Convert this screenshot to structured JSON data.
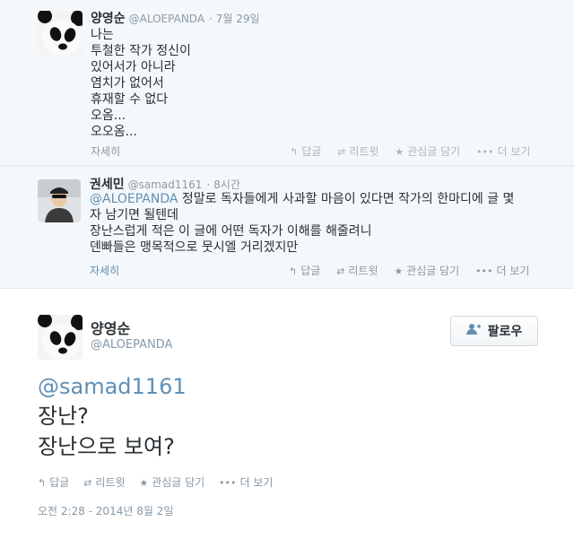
{
  "replies": [
    {
      "fullname": "양영순",
      "handle": "@ALOEPANDA",
      "time": "· 7월 29일",
      "lines": [
        "나는",
        "투철한 작가 정신이",
        "있어서가 아니라",
        "염치가 없어서",
        "휴재할 수 없다",
        "오옴...",
        "오오옴..."
      ],
      "expand": "자세히",
      "actions": {
        "reply": "답글",
        "retweet": "리트윗",
        "favorite": "관심글 담기",
        "more": "더 보기"
      }
    },
    {
      "fullname": "권세민",
      "handle": "@samad1161",
      "time": "· 8시간",
      "mention": "@ALOEPANDA",
      "lines": [
        "정말로 독자들에게 사과할 마음이 있다면 작가의 한마디에 글 몇",
        "자 남기면 될텐데",
        "장난스럽게 적은 이 글에 어떤 독자가 이해를 해줄려니",
        "덴빠들은 맹목적으로 뭇시엘 거리겠지만"
      ],
      "expand": "자세히",
      "actions": {
        "reply": "답글",
        "retweet": "리트윗",
        "favorite": "관심글 담기",
        "more": "더 보기"
      }
    }
  ],
  "main": {
    "fullname": "양영순",
    "handle": "@ALOEPANDA",
    "follow_label": "팔로우",
    "mention": "@samad1161",
    "lines": [
      "장난?",
      "장난으로 보여?"
    ],
    "actions": {
      "reply": "답글",
      "retweet": "리트윗",
      "favorite": "관심글 담기",
      "more": "더 보기"
    },
    "timestamp": "오전 2:28 - 2014년 8월 2일"
  },
  "colors": {
    "link": "#5f8fb5",
    "muted": "#8899a6",
    "text": "#292f33",
    "bg_reply": "#f5f8fa"
  },
  "icons": [
    "panda-avatar",
    "person-avatar",
    "reply-icon",
    "retweet-icon",
    "star-icon",
    "more-icon",
    "follow-person-icon"
  ]
}
